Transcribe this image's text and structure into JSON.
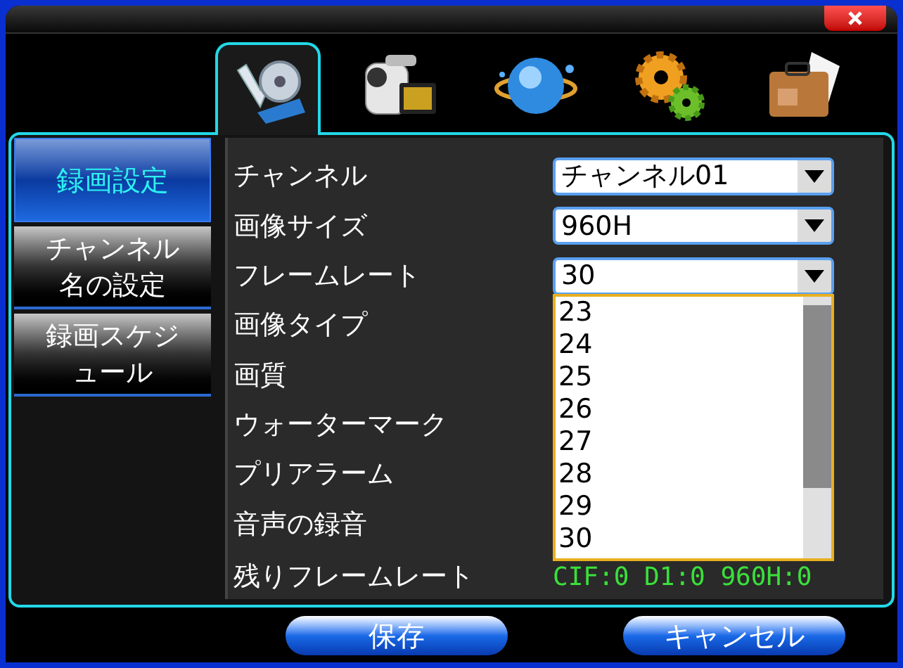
{
  "tabs": [
    {
      "kind": "film",
      "selected": true
    },
    {
      "kind": "camera",
      "selected": false
    },
    {
      "kind": "globe",
      "selected": false
    },
    {
      "kind": "gears",
      "selected": false
    },
    {
      "kind": "case",
      "selected": false
    }
  ],
  "sidebar": {
    "items": [
      {
        "label": "録画設定",
        "selected": true
      },
      {
        "label": "チャンネル名の設定",
        "selected": false
      },
      {
        "label": "録画スケジュール",
        "selected": false
      }
    ]
  },
  "settings": [
    {
      "label": "チャンネル",
      "kind": "select",
      "value": "チャンネル01"
    },
    {
      "label": "画像サイズ",
      "kind": "select",
      "value": "960H"
    },
    {
      "label": "フレームレート",
      "kind": "select",
      "value": "30",
      "expanded": true,
      "options": [
        "23",
        "24",
        "25",
        "26",
        "27",
        "28",
        "29",
        "30"
      ]
    },
    {
      "label": "画像タイプ",
      "kind": "none"
    },
    {
      "label": "画質",
      "kind": "none"
    },
    {
      "label": "ウォーターマーク",
      "kind": "none"
    },
    {
      "label": "プリアラーム",
      "kind": "none"
    },
    {
      "label": "音声の録音",
      "kind": "none"
    },
    {
      "label": "残りフレームレート",
      "kind": "text",
      "value": "CIF:0 D1:0 960H:0"
    }
  ],
  "buttons": [
    "保存",
    "キャンセル"
  ]
}
